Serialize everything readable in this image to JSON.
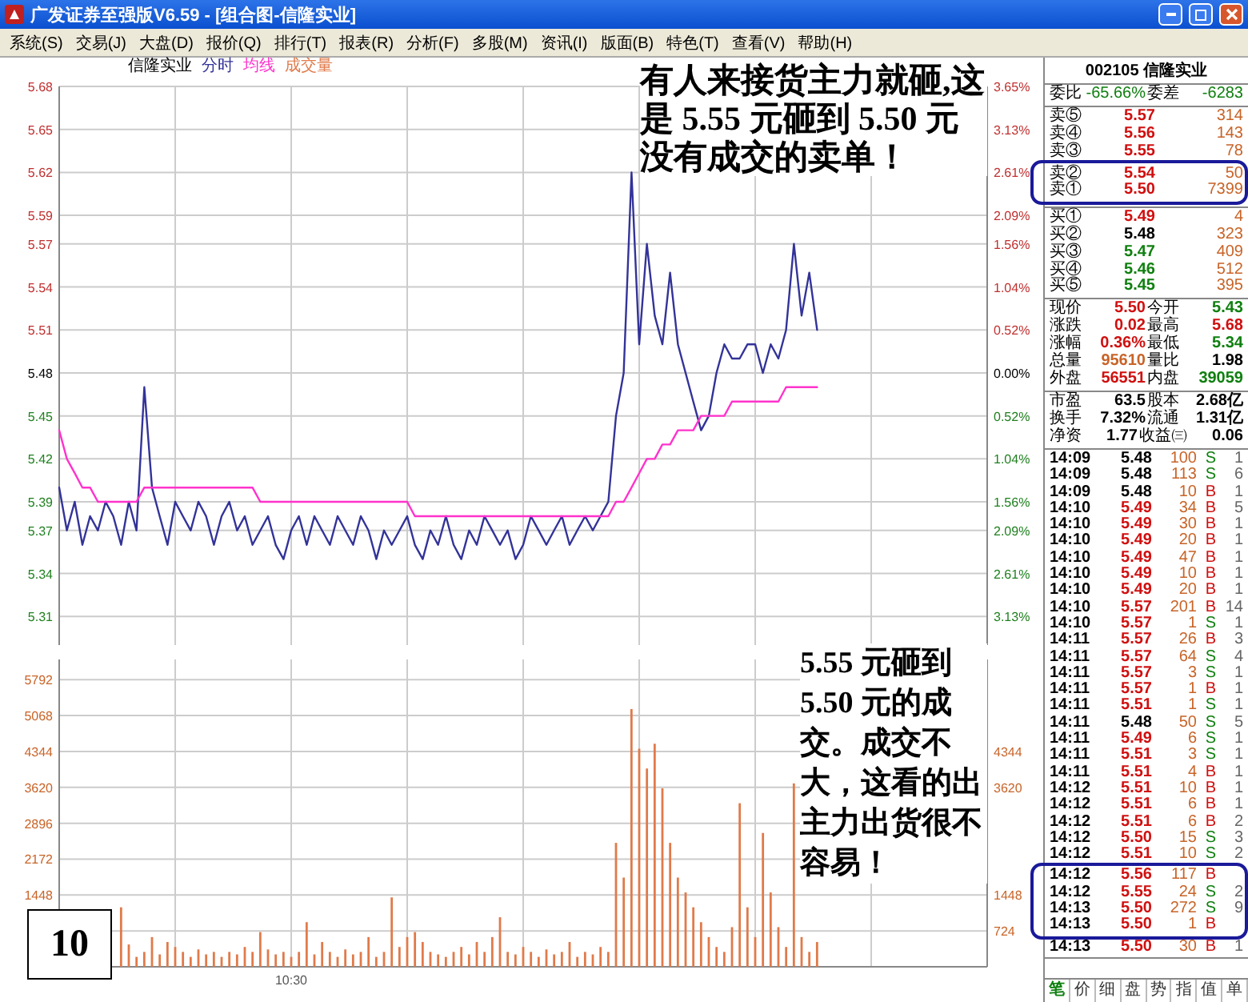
{
  "window": {
    "title": "广发证券至强版V6.59 - [组合图-信隆实业]"
  },
  "menu": [
    "系统(S)",
    "交易(J)",
    "大盘(D)",
    "报价(Q)",
    "排行(T)",
    "报表(R)",
    "分析(F)",
    "多股(M)",
    "资讯(I)",
    "版面(B)",
    "特色(T)",
    "查看(V)",
    "帮助(H)"
  ],
  "price_chart": {
    "right_labels": [
      {
        "label": "3.65%",
        "color": "#c03030"
      },
      {
        "label": "3.13%",
        "color": "#c03030"
      },
      {
        "label": "2.61%",
        "color": "#c03030"
      },
      {
        "label": "2.09%",
        "color": "#c03030"
      },
      {
        "label": "1.56%",
        "color": "#c03030"
      },
      {
        "label": "1.04%",
        "color": "#c03030"
      },
      {
        "label": "0.52%",
        "color": "#c03030"
      },
      {
        "label": "0.00%",
        "color": "#000000"
      },
      {
        "label": "0.52%",
        "color": "#208020"
      },
      {
        "label": "1.04%",
        "color": "#208020"
      },
      {
        "label": "1.56%",
        "color": "#208020"
      },
      {
        "label": "2.09%",
        "color": "#208020"
      },
      {
        "label": "2.61%",
        "color": "#208020"
      },
      {
        "label": "3.13%",
        "color": "#208020"
      }
    ],
    "chart_data": {
      "type": "line",
      "title": "信隆实业",
      "grid": true,
      "ylim": [
        5.29,
        5.68
      ],
      "yticks": [
        5.68,
        5.65,
        5.62,
        5.59,
        5.57,
        5.54,
        5.51,
        5.48,
        5.45,
        5.42,
        5.39,
        5.37,
        5.34,
        5.31
      ],
      "categories": [
        null,
        null,
        null,
        null,
        null,
        null,
        null,
        null,
        null,
        null,
        null,
        null,
        null,
        null,
        null,
        null,
        null,
        null,
        null,
        null,
        null,
        null,
        null,
        null,
        null,
        null,
        null,
        null,
        null,
        null,
        null,
        null,
        null,
        null,
        null,
        null,
        null,
        null,
        null,
        null,
        null,
        null,
        null,
        null,
        null,
        null,
        null,
        null,
        null,
        null,
        null,
        null,
        null,
        null,
        null,
        null,
        null,
        null,
        null,
        null,
        null,
        null,
        null,
        null,
        null,
        null,
        null,
        null,
        null,
        null,
        null,
        null,
        null,
        null,
        null,
        null,
        null,
        null,
        null,
        null,
        null,
        null,
        null,
        null,
        null,
        null,
        null,
        null,
        null,
        null,
        null,
        null,
        null,
        null,
        null,
        null,
        null,
        null,
        null,
        null,
        null,
        null,
        null,
        null,
        null,
        null,
        null,
        null,
        null,
        null,
        null,
        null,
        null,
        null,
        null,
        null,
        null,
        null,
        null,
        null,
        null
      ],
      "series": [
        {
          "name": "分时",
          "color": "#333399",
          "values": [
            5.4,
            5.37,
            5.39,
            5.36,
            5.38,
            5.37,
            5.39,
            5.38,
            5.36,
            5.39,
            5.37,
            5.47,
            5.4,
            5.38,
            5.36,
            5.39,
            5.38,
            5.37,
            5.39,
            5.38,
            5.36,
            5.38,
            5.39,
            5.37,
            5.38,
            5.36,
            5.37,
            5.38,
            5.36,
            5.35,
            5.37,
            5.38,
            5.36,
            5.38,
            5.37,
            5.36,
            5.38,
            5.37,
            5.36,
            5.38,
            5.37,
            5.35,
            5.37,
            5.36,
            5.37,
            5.38,
            5.36,
            5.35,
            5.37,
            5.36,
            5.38,
            5.36,
            5.35,
            5.37,
            5.36,
            5.38,
            5.37,
            5.36,
            5.37,
            5.35,
            5.36,
            5.38,
            5.37,
            5.36,
            5.37,
            5.38,
            5.36,
            5.37,
            5.38,
            5.37,
            5.38,
            5.39,
            5.45,
            5.48,
            5.62,
            5.5,
            5.57,
            5.52,
            5.5,
            5.55,
            5.5,
            5.48,
            5.46,
            5.44,
            5.45,
            5.48,
            5.5,
            5.49,
            5.49,
            5.5,
            5.5,
            5.48,
            5.5,
            5.49,
            5.51,
            5.57,
            5.52,
            5.55,
            5.51,
            null,
            null,
            null,
            null,
            null,
            null,
            null,
            null,
            null,
            null,
            null,
            null,
            null,
            null,
            null,
            null,
            null,
            null,
            null,
            null,
            null,
            null
          ]
        },
        {
          "name": "均线",
          "color": "#ff33cc",
          "values": [
            5.44,
            5.42,
            5.41,
            5.4,
            5.4,
            5.39,
            5.39,
            5.39,
            5.39,
            5.39,
            5.39,
            5.4,
            5.4,
            5.4,
            5.4,
            5.4,
            5.4,
            5.4,
            5.4,
            5.4,
            5.4,
            5.4,
            5.4,
            5.4,
            5.4,
            5.4,
            5.39,
            5.39,
            5.39,
            5.39,
            5.39,
            5.39,
            5.39,
            5.39,
            5.39,
            5.39,
            5.39,
            5.39,
            5.39,
            5.39,
            5.39,
            5.39,
            5.39,
            5.39,
            5.39,
            5.39,
            5.38,
            5.38,
            5.38,
            5.38,
            5.38,
            5.38,
            5.38,
            5.38,
            5.38,
            5.38,
            5.38,
            5.38,
            5.38,
            5.38,
            5.38,
            5.38,
            5.38,
            5.38,
            5.38,
            5.38,
            5.38,
            5.38,
            5.38,
            5.38,
            5.38,
            5.38,
            5.39,
            5.39,
            5.4,
            5.41,
            5.42,
            5.42,
            5.43,
            5.43,
            5.44,
            5.44,
            5.44,
            5.45,
            5.45,
            5.45,
            5.45,
            5.46,
            5.46,
            5.46,
            5.46,
            5.46,
            5.46,
            5.46,
            5.47,
            5.47,
            5.47,
            5.47,
            5.47,
            null,
            null,
            null,
            null,
            null,
            null,
            null,
            null,
            null,
            null,
            null,
            null,
            null,
            null,
            null,
            null,
            null,
            null,
            null,
            null,
            null,
            null
          ]
        }
      ]
    }
  },
  "volume_chart": {
    "right_labels": [
      {
        "covered": true
      },
      {
        "covered": true
      },
      {
        "label": "4344"
      },
      {
        "label": "3620"
      },
      {
        "covered": true
      },
      {
        "covered": true
      },
      {
        "label": "1448"
      },
      {
        "label": "724"
      }
    ],
    "chart_data": {
      "type": "bar",
      "grid": true,
      "ylim": [
        0,
        6200
      ],
      "yticks": [
        5792,
        5068,
        4344,
        3620,
        2896,
        2172,
        1448
      ],
      "categories": [
        null,
        null,
        null,
        null,
        null,
        null,
        null,
        null,
        null,
        null,
        null,
        null,
        null,
        null,
        null,
        null,
        null,
        null,
        null,
        null,
        null,
        null,
        null,
        null,
        null,
        null,
        null,
        null,
        null,
        null,
        "10:30",
        null,
        null,
        null,
        null,
        null,
        null,
        null,
        null,
        null,
        null,
        null,
        null,
        null,
        null,
        null,
        null,
        null,
        null,
        null,
        null,
        null,
        null,
        null,
        null,
        null,
        null,
        null,
        null,
        null,
        null,
        null,
        null,
        null,
        null,
        null,
        null,
        null,
        null,
        null,
        null,
        null,
        null,
        null,
        null,
        null,
        null,
        null,
        null,
        null,
        null,
        null,
        null,
        null,
        null,
        null,
        null,
        null,
        null,
        null,
        null,
        null,
        null,
        null,
        null,
        null,
        null,
        null,
        null,
        null,
        null,
        null,
        null,
        null,
        null,
        null,
        null,
        null,
        null,
        null,
        null,
        null,
        null,
        null,
        null,
        null,
        null,
        null,
        null,
        null,
        null
      ],
      "series": [
        {
          "name": "成交量",
          "color": "#e07a4a",
          "values": [
            null,
            null,
            null,
            null,
            null,
            null,
            null,
            null,
            1200,
            450,
            200,
            300,
            600,
            250,
            500,
            400,
            300,
            200,
            350,
            250,
            300,
            200,
            300,
            250,
            400,
            300,
            700,
            350,
            250,
            300,
            200,
            300,
            900,
            250,
            500,
            300,
            200,
            350,
            250,
            300,
            600,
            200,
            300,
            1400,
            400,
            600,
            700,
            500,
            300,
            250,
            200,
            300,
            400,
            250,
            500,
            300,
            600,
            1000,
            300,
            250,
            400,
            300,
            200,
            350,
            250,
            300,
            500,
            200,
            300,
            250,
            400,
            300,
            2500,
            1800,
            5200,
            4400,
            4000,
            4500,
            3600,
            2500,
            1800,
            1500,
            1200,
            900,
            600,
            400,
            300,
            800,
            3300,
            1200,
            600,
            2700,
            1500,
            800,
            400,
            3700,
            600,
            300,
            500,
            null,
            null,
            null,
            null,
            null,
            null,
            null,
            null,
            null,
            null,
            null,
            null,
            null,
            null,
            null,
            null,
            null,
            null,
            null,
            null,
            null,
            null
          ]
        }
      ]
    }
  },
  "annotations": [
    "有人来接货主力就砸,这是 5.55 元砸到 5.50 元没有成交的卖单！",
    "5.55 元砸到 5.50 元的成交。成交不大，这看的出主力出货很不容易！"
  ],
  "page_number": "10",
  "quote": {
    "code": "002105",
    "name": "信隆实业",
    "ratio": [
      {
        "label": "委比",
        "value": "-65.66%",
        "color": "#108010"
      },
      {
        "label": "委差",
        "value": "-6283",
        "color": "#108010"
      }
    ],
    "asks": [
      {
        "label": "卖⑤",
        "price": "5.57",
        "color": "#d01010",
        "volume": "314",
        "highlighted": false
      },
      {
        "label": "卖④",
        "price": "5.56",
        "color": "#d01010",
        "volume": "143",
        "highlighted": false
      },
      {
        "label": "卖③",
        "price": "5.55",
        "color": "#d01010",
        "volume": "78",
        "highlighted": false
      },
      {
        "label": "卖②",
        "price": "5.54",
        "color": "#d01010",
        "volume": "50",
        "highlighted": true
      },
      {
        "label": "卖①",
        "price": "5.50",
        "color": "#d01010",
        "volume": "7399",
        "highlighted": true
      }
    ],
    "bids": [
      {
        "label": "买①",
        "price": "5.49",
        "color": "#d01010",
        "volume": "4",
        "highlighted": false
      },
      {
        "label": "买②",
        "price": "5.48",
        "color": "#000000",
        "volume": "323",
        "highlighted": false
      },
      {
        "label": "买③",
        "price": "5.47",
        "color": "#108010",
        "volume": "409",
        "highlighted": false
      },
      {
        "label": "买④",
        "price": "5.46",
        "color": "#108010",
        "volume": "512",
        "highlighted": false
      },
      {
        "label": "买⑤",
        "price": "5.45",
        "color": "#108010",
        "volume": "395",
        "highlighted": false
      }
    ],
    "stats": [
      [
        {
          "label": "现价",
          "value": "5.50",
          "color": "#d01010"
        },
        {
          "label": "今开",
          "value": "5.43",
          "color": "#108010"
        }
      ],
      [
        {
          "label": "涨跌",
          "value": "0.02",
          "color": "#d01010"
        },
        {
          "label": "最高",
          "value": "5.68",
          "color": "#d01010"
        }
      ],
      [
        {
          "label": "涨幅",
          "value": "0.36%",
          "color": "#d01010"
        },
        {
          "label": "最低",
          "value": "5.34",
          "color": "#108010"
        }
      ],
      [
        {
          "label": "总量",
          "value": "95610",
          "color": "#c86428"
        },
        {
          "label": "量比",
          "value": "1.98",
          "color": "#000000"
        }
      ],
      [
        {
          "label": "外盘",
          "value": "56551",
          "color": "#d01010"
        },
        {
          "label": "内盘",
          "value": "39059",
          "color": "#108010"
        }
      ]
    ],
    "fundamentals": [
      [
        {
          "label": "市盈",
          "value": "63.5"
        },
        {
          "label": "股本",
          "value": "2.68亿"
        }
      ],
      [
        {
          "label": "换手",
          "value": "7.32%"
        },
        {
          "label": "流通",
          "value": "1.31亿"
        }
      ],
      [
        {
          "label": "净资",
          "value": "1.77"
        },
        {
          "label": "收益㈢",
          "value": "0.06"
        }
      ]
    ]
  },
  "trades": [
    {
      "time": "14:09",
      "price": "5.48",
      "color": "#000000",
      "volume": "100",
      "side": {
        "label": "S",
        "color": "#108010"
      },
      "count": "1",
      "highlighted": false
    },
    {
      "time": "14:09",
      "price": "5.48",
      "color": "#000000",
      "volume": "113",
      "side": {
        "label": "S",
        "color": "#108010"
      },
      "count": "6",
      "highlighted": false
    },
    {
      "time": "14:09",
      "price": "5.48",
      "color": "#000000",
      "volume": "10",
      "side": {
        "label": "B",
        "color": "#d01010"
      },
      "count": "1",
      "highlighted": false
    },
    {
      "time": "14:10",
      "price": "5.49",
      "color": "#d01010",
      "volume": "34",
      "side": {
        "label": "B",
        "color": "#d01010"
      },
      "count": "5",
      "highlighted": false
    },
    {
      "time": "14:10",
      "price": "5.49",
      "color": "#d01010",
      "volume": "30",
      "side": {
        "label": "B",
        "color": "#d01010"
      },
      "count": "1",
      "highlighted": false
    },
    {
      "time": "14:10",
      "price": "5.49",
      "color": "#d01010",
      "volume": "20",
      "side": {
        "label": "B",
        "color": "#d01010"
      },
      "count": "1",
      "highlighted": false
    },
    {
      "time": "14:10",
      "price": "5.49",
      "color": "#d01010",
      "volume": "47",
      "side": {
        "label": "B",
        "color": "#d01010"
      },
      "count": "1",
      "highlighted": false
    },
    {
      "time": "14:10",
      "price": "5.49",
      "color": "#d01010",
      "volume": "10",
      "side": {
        "label": "B",
        "color": "#d01010"
      },
      "count": "1",
      "highlighted": false
    },
    {
      "time": "14:10",
      "price": "5.49",
      "color": "#d01010",
      "volume": "20",
      "side": {
        "label": "B",
        "color": "#d01010"
      },
      "count": "1",
      "highlighted": false
    },
    {
      "time": "14:10",
      "price": "5.57",
      "color": "#d01010",
      "volume": "201",
      "side": {
        "label": "B",
        "color": "#d01010"
      },
      "count": "14",
      "highlighted": false
    },
    {
      "time": "14:10",
      "price": "5.57",
      "color": "#d01010",
      "volume": "1",
      "side": {
        "label": "S",
        "color": "#108010"
      },
      "count": "1",
      "highlighted": false
    },
    {
      "time": "14:11",
      "price": "5.57",
      "color": "#d01010",
      "volume": "26",
      "side": {
        "label": "B",
        "color": "#d01010"
      },
      "count": "3",
      "highlighted": false
    },
    {
      "time": "14:11",
      "price": "5.57",
      "color": "#d01010",
      "volume": "64",
      "side": {
        "label": "S",
        "color": "#108010"
      },
      "count": "4",
      "highlighted": false
    },
    {
      "time": "14:11",
      "price": "5.57",
      "color": "#d01010",
      "volume": "3",
      "side": {
        "label": "S",
        "color": "#108010"
      },
      "count": "1",
      "highlighted": false
    },
    {
      "time": "14:11",
      "price": "5.57",
      "color": "#d01010",
      "volume": "1",
      "side": {
        "label": "B",
        "color": "#d01010"
      },
      "count": "1",
      "highlighted": false
    },
    {
      "time": "14:11",
      "price": "5.51",
      "color": "#d01010",
      "volume": "1",
      "side": {
        "label": "S",
        "color": "#108010"
      },
      "count": "1",
      "highlighted": false
    },
    {
      "time": "14:11",
      "price": "5.48",
      "color": "#000000",
      "volume": "50",
      "side": {
        "label": "S",
        "color": "#108010"
      },
      "count": "5",
      "highlighted": false
    },
    {
      "time": "14:11",
      "price": "5.49",
      "color": "#d01010",
      "volume": "6",
      "side": {
        "label": "S",
        "color": "#108010"
      },
      "count": "1",
      "highlighted": false
    },
    {
      "time": "14:11",
      "price": "5.51",
      "color": "#d01010",
      "volume": "3",
      "side": {
        "label": "S",
        "color": "#108010"
      },
      "count": "1",
      "highlighted": false
    },
    {
      "time": "14:11",
      "price": "5.51",
      "color": "#d01010",
      "volume": "4",
      "side": {
        "label": "B",
        "color": "#d01010"
      },
      "count": "1",
      "highlighted": false
    },
    {
      "time": "14:12",
      "price": "5.51",
      "color": "#d01010",
      "volume": "10",
      "side": {
        "label": "B",
        "color": "#d01010"
      },
      "count": "1",
      "highlighted": false
    },
    {
      "time": "14:12",
      "price": "5.51",
      "color": "#d01010",
      "volume": "6",
      "side": {
        "label": "B",
        "color": "#d01010"
      },
      "count": "1",
      "highlighted": false
    },
    {
      "time": "14:12",
      "price": "5.51",
      "color": "#d01010",
      "volume": "6",
      "side": {
        "label": "B",
        "color": "#d01010"
      },
      "count": "2",
      "highlighted": false
    },
    {
      "time": "14:12",
      "price": "5.50",
      "color": "#d01010",
      "volume": "15",
      "side": {
        "label": "S",
        "color": "#108010"
      },
      "count": "3",
      "highlighted": false
    },
    {
      "time": "14:12",
      "price": "5.51",
      "color": "#d01010",
      "volume": "10",
      "side": {
        "label": "S",
        "color": "#108010"
      },
      "count": "2",
      "highlighted": false
    },
    {
      "time": "14:12",
      "price": "5.56",
      "color": "#d01010",
      "volume": "117",
      "side": {
        "label": "B",
        "color": "#d01010"
      },
      "highlighted": true
    },
    {
      "time": "14:12",
      "price": "5.55",
      "color": "#d01010",
      "volume": "24",
      "side": {
        "label": "S",
        "color": "#108010"
      },
      "count": "2",
      "highlighted": true
    },
    {
      "time": "14:13",
      "price": "5.50",
      "color": "#d01010",
      "volume": "272",
      "side": {
        "label": "S",
        "color": "#108010"
      },
      "count": "9",
      "highlighted": true
    },
    {
      "time": "14:13",
      "price": "5.50",
      "color": "#d01010",
      "volume": "1",
      "side": {
        "label": "B",
        "color": "#d01010"
      },
      "highlighted": true
    },
    {
      "time": "14:13",
      "price": "5.50",
      "color": "#d01010",
      "volume": "30",
      "side": {
        "label": "B",
        "color": "#d01010"
      },
      "count": "1",
      "highlighted": false
    }
  ],
  "bottom_tabs": [
    {
      "label": "笔",
      "selected": true
    },
    {
      "label": "价",
      "selected": false
    },
    {
      "label": "细",
      "selected": false
    },
    {
      "label": "盘",
      "selected": false
    },
    {
      "label": "势",
      "selected": false
    },
    {
      "label": "指",
      "selected": false
    },
    {
      "label": "值",
      "selected": false
    },
    {
      "label": "单",
      "selected": false
    }
  ]
}
